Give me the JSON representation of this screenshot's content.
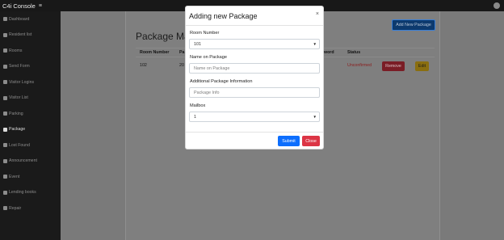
{
  "topbar": {
    "brand": "C4i Console",
    "menu_icon": "hamburger-icon",
    "user_icon": "user-icon"
  },
  "sidebar": {
    "items": [
      {
        "label": "Dashboard",
        "icon": "dashboard-icon"
      },
      {
        "label": "Resident list",
        "icon": "users-icon"
      },
      {
        "label": "Rooms",
        "icon": "rooms-icon"
      },
      {
        "label": "Send Form",
        "icon": "send-icon"
      },
      {
        "label": "Visitor Logins",
        "icon": "login-icon"
      },
      {
        "label": "Visitor List",
        "icon": "visitor-icon"
      },
      {
        "label": "Parking",
        "icon": "parking-icon"
      },
      {
        "label": "Package",
        "icon": "package-icon",
        "active": true
      },
      {
        "label": "Lost Found",
        "icon": "lost-found-icon"
      },
      {
        "label": "Announcement",
        "icon": "announcement-icon"
      },
      {
        "label": "Event",
        "icon": "event-icon"
      },
      {
        "label": "Lending books",
        "icon": "book-icon"
      },
      {
        "label": "Repair",
        "icon": "wrench-icon"
      }
    ]
  },
  "page": {
    "title": "Package Ma",
    "add_button": "Add New Package",
    "table": {
      "headers": [
        "Room Number",
        "Pa",
        "sword",
        "Status"
      ],
      "rows": [
        {
          "room": "102",
          "pa": "20",
          "status": "Unconfirmed",
          "remove": "Remove",
          "edit": "Edit"
        }
      ]
    }
  },
  "modal": {
    "title": "Adding new Package",
    "close_glyph": "×",
    "room_label": "Room Number",
    "room_value": "101",
    "name_label": "Name on Package",
    "name_placeholder": "Name on Package",
    "info_label": "Additional Package Information",
    "info_placeholder": "Package Info",
    "mailbox_label": "Mailbox",
    "mailbox_value": "1",
    "submit": "Submit",
    "close": "Close"
  }
}
